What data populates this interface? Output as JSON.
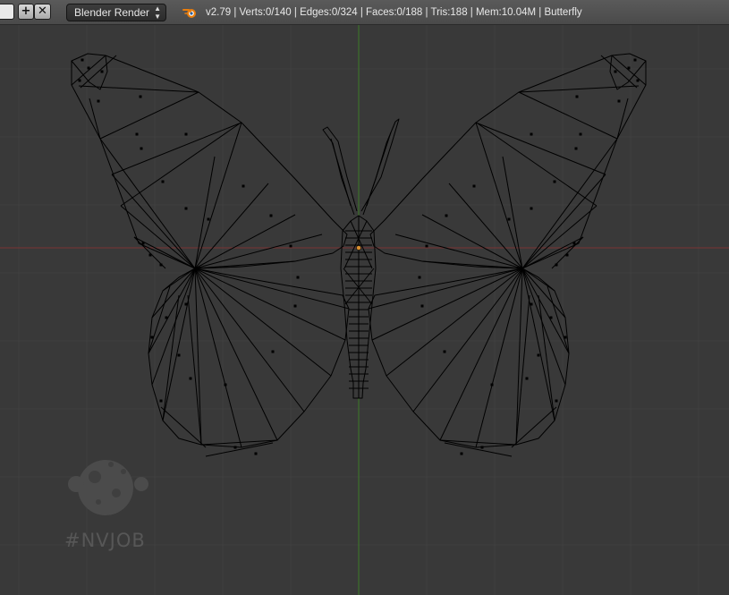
{
  "header": {
    "add_icon": "plus-icon",
    "close_icon": "close-icon",
    "render_engine": "Blender Render",
    "engine_icon": "updown-arrows-icon",
    "logo_icon": "blender-logo-icon",
    "stats": "v2.79 | Verts:0/140 | Edges:0/324 | Faces:0/188 | Tris:188 | Mem:10.04M | Butterfly"
  },
  "viewport": {
    "object_name": "Butterfly",
    "view": "front orthographic wireframe"
  },
  "watermark": {
    "text": "#NVJOB",
    "icon": "moon-logo-icon"
  },
  "colors": {
    "background": "#393939",
    "grid": "#404040",
    "x_axis": "#7a3434",
    "z_axis": "#3d7a27",
    "wire": "#000000",
    "origin": "#d89030"
  }
}
